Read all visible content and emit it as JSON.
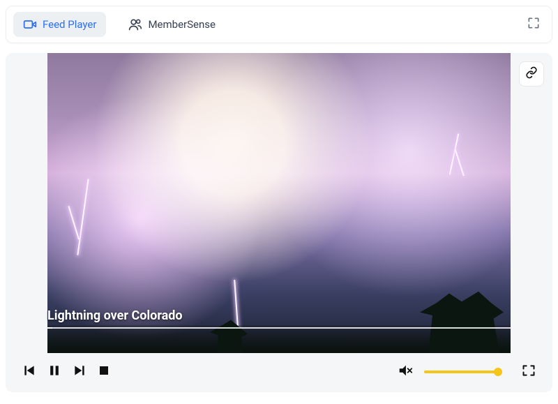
{
  "tabs": {
    "feed_player": "Feed Player",
    "member_sense": "MemberSense"
  },
  "media": {
    "title": "Lightning over Colorado"
  },
  "volume": {
    "level": 100,
    "muted": true
  },
  "colors": {
    "accent_blue": "#2b6ef2",
    "volume_yellow": "#f5c518"
  }
}
